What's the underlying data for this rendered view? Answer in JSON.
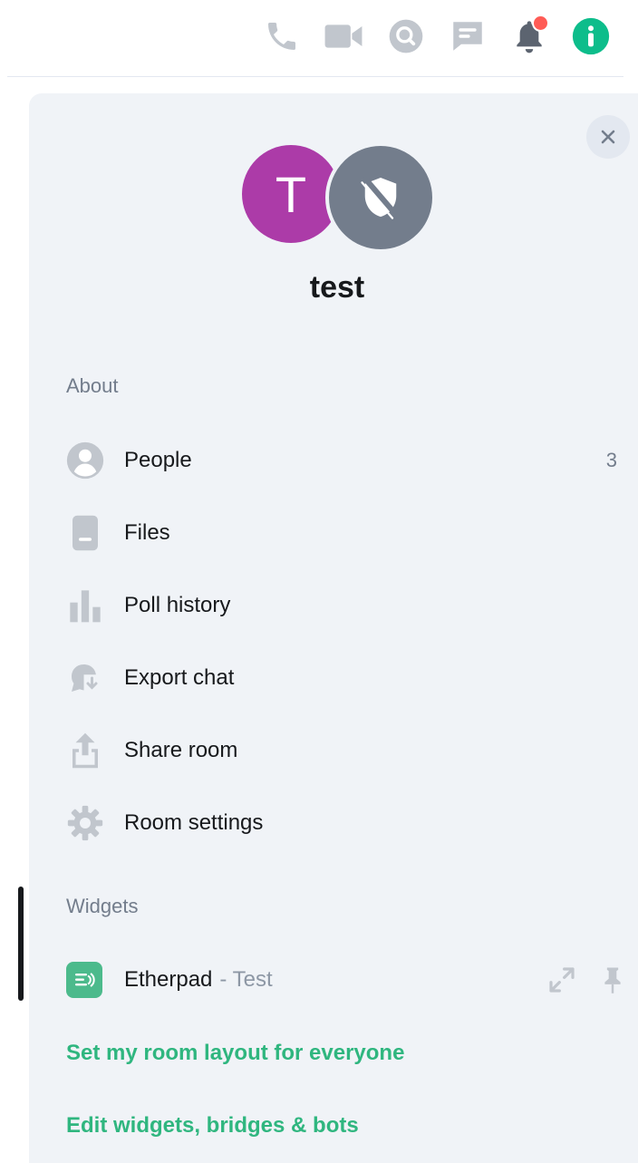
{
  "header": {
    "icons": [
      "phone-icon",
      "video-icon",
      "search-icon",
      "threads-icon",
      "bell-icon",
      "info-icon"
    ],
    "accent_color": "#0dbd8b",
    "notification_dot_color": "#ff5b55"
  },
  "room": {
    "avatar_letter": "T",
    "avatar_color": "#ac3ba8",
    "name": "test"
  },
  "about": {
    "heading": "About",
    "items": [
      {
        "label": "People",
        "count": "3",
        "icon": "person-icon"
      },
      {
        "label": "Files",
        "icon": "file-icon"
      },
      {
        "label": "Poll history",
        "icon": "poll-icon"
      },
      {
        "label": "Export chat",
        "icon": "export-chat-icon"
      },
      {
        "label": "Share room",
        "icon": "share-icon"
      },
      {
        "label": "Room settings",
        "icon": "gear-icon"
      }
    ]
  },
  "widgets": {
    "heading": "Widgets",
    "items": [
      {
        "name": "Etherpad",
        "separator": "- Test",
        "icon": "etherpad-icon"
      }
    ],
    "links": {
      "set_layout": "Set my room layout for everyone",
      "edit": "Edit widgets, bridges & bots"
    }
  }
}
